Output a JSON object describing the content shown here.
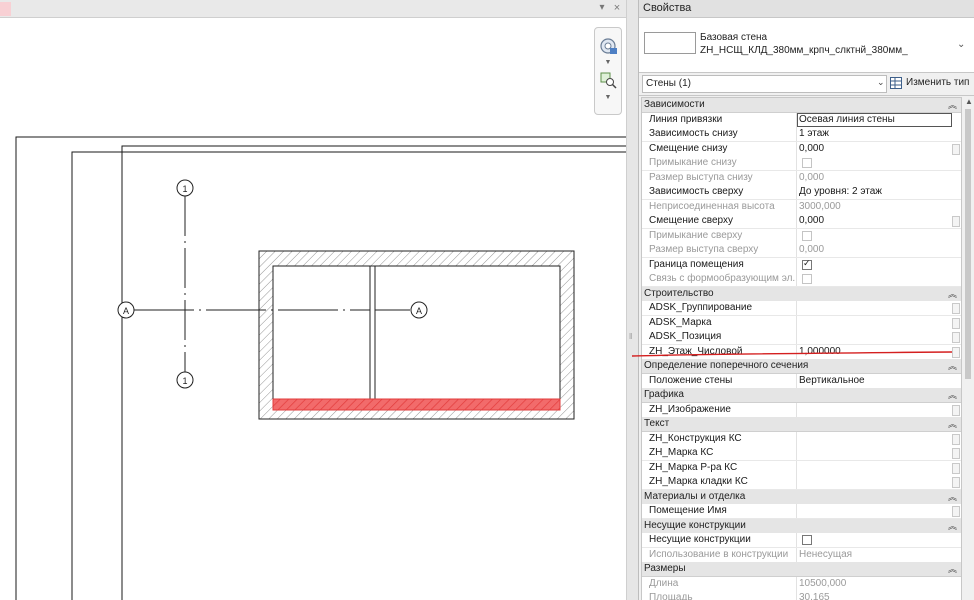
{
  "view": {
    "collapse_glyph": "▾",
    "close_glyph": "×",
    "grid_labels": {
      "top": "1",
      "bottom": "1",
      "left": "A",
      "right": "A"
    },
    "hatched_wall_color": "#e23b3b",
    "annotation_underline_color": "#d41f1f"
  },
  "properties": {
    "title": "Свойства",
    "type_family": "Базовая стена",
    "type_name": "ZH_НСЩ_КЛД_380мм_крпч_слктнй_380мм_",
    "type_dropdown_glyph": "⌄",
    "filter": "Стены (1)",
    "edit_type_label": "Изменить тип",
    "groups": [
      {
        "label": "Зависимости",
        "rows": [
          {
            "name": "Линия привязки",
            "value": "Осевая линия стены",
            "boxed": true
          },
          {
            "name": "Зависимость снизу",
            "value": "1 этаж"
          },
          {
            "name": "Смещение снизу",
            "value": "0,000",
            "button": true
          },
          {
            "name": "Примыкание снизу",
            "checkbox": "off",
            "disabled": true
          },
          {
            "name": "Размер выступа снизу",
            "value": "0,000",
            "disabled": true
          },
          {
            "name": "Зависимость сверху",
            "value": "До уровня: 2 этаж"
          },
          {
            "name": "Неприсоединенная высота",
            "value": "3000,000",
            "disabled": true
          },
          {
            "name": "Смещение сверху",
            "value": "0,000",
            "button": true
          },
          {
            "name": "Примыкание сверху",
            "checkbox": "off",
            "disabled": true
          },
          {
            "name": "Размер выступа сверху",
            "value": "0,000",
            "disabled": true
          },
          {
            "name": "Граница помещения",
            "checkbox": "on"
          },
          {
            "name": "Связь с формообразующим эл...",
            "checkbox": "off",
            "disabled": true
          }
        ]
      },
      {
        "label": "Строительство",
        "rows": [
          {
            "name": "ADSK_Группирование",
            "value": "",
            "button": true
          },
          {
            "name": "ADSK_Марка",
            "value": "",
            "button": true
          },
          {
            "name": "ADSK_Позиция",
            "value": "",
            "button": true
          },
          {
            "name": "ZH_Этаж_Числовой",
            "value": "1,000000",
            "button": true,
            "underlined": true
          }
        ]
      },
      {
        "label": "Определение поперечного сечения",
        "rows": [
          {
            "name": "Положение стены",
            "value": "Вертикальное"
          }
        ]
      },
      {
        "label": "Графика",
        "rows": [
          {
            "name": "ZH_Изображение",
            "value": "",
            "button": true
          }
        ]
      },
      {
        "label": "Текст",
        "rows": [
          {
            "name": "ZH_Конструкция КС",
            "value": "",
            "button": true
          },
          {
            "name": "ZH_Марка КС",
            "value": "",
            "button": true
          },
          {
            "name": "ZH_Марка Р-ра КС",
            "value": "",
            "button": true
          },
          {
            "name": "ZH_Марка кладки КС",
            "value": "",
            "button": true
          }
        ]
      },
      {
        "label": "Материалы и отделка",
        "rows": [
          {
            "name": "Помещение Имя",
            "value": "",
            "button": true
          }
        ]
      },
      {
        "label": "Несущие конструкции",
        "rows": [
          {
            "name": "Несущие конструкции",
            "checkbox": "off"
          },
          {
            "name": "Использование в конструкции",
            "value": "Ненесущая",
            "disabled": true
          }
        ]
      },
      {
        "label": "Размеры",
        "rows": [
          {
            "name": "Длина",
            "value": "10500,000",
            "disabled": true
          },
          {
            "name": "Площадь",
            "value": "30,165",
            "disabled": true
          }
        ]
      }
    ]
  }
}
